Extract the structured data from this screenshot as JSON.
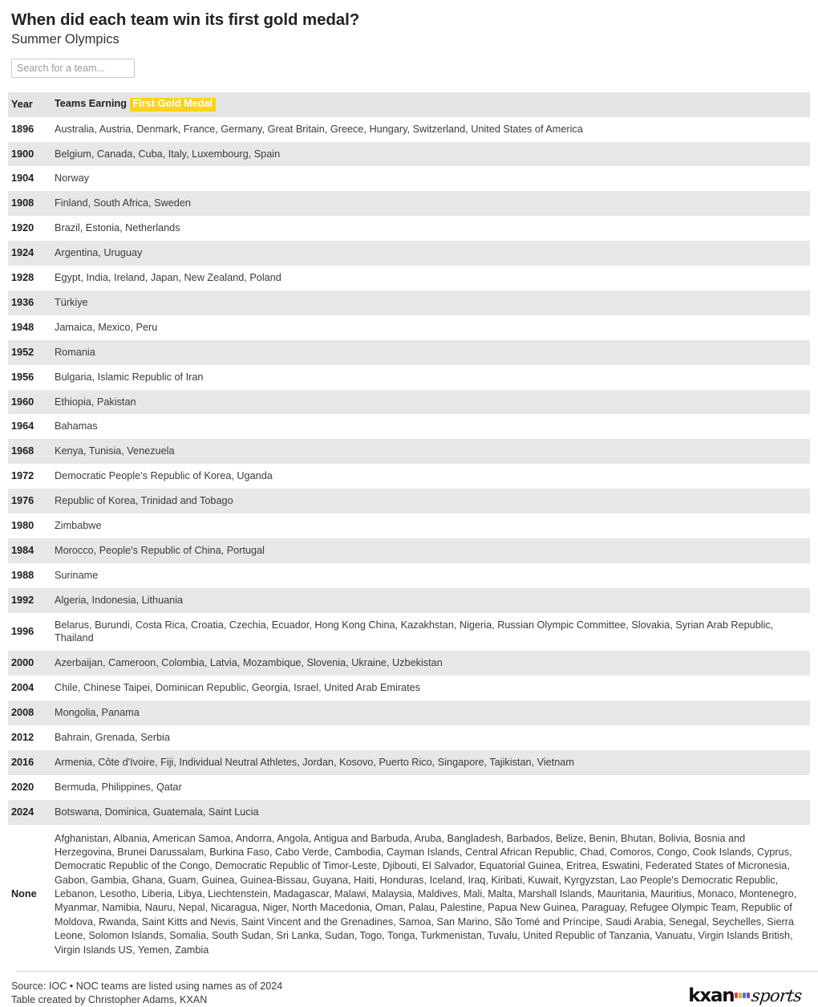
{
  "header": {
    "title": "When did each team win its first gold medal?",
    "subtitle": "Summer Olympics"
  },
  "search": {
    "placeholder": "Search for a team...",
    "value": ""
  },
  "table": {
    "columns": {
      "year": "Year",
      "teams_prefix": "Teams Earning",
      "teams_highlight": "First Gold Medal"
    },
    "rows": [
      {
        "year": "1896",
        "teams": "Australia, Austria, Denmark, France, Germany, Great Britain, Greece, Hungary, Switzerland, United States of America"
      },
      {
        "year": "1900",
        "teams": "Belgium, Canada, Cuba, Italy, Luxembourg, Spain"
      },
      {
        "year": "1904",
        "teams": "Norway"
      },
      {
        "year": "1908",
        "teams": "Finland, South Africa, Sweden"
      },
      {
        "year": "1920",
        "teams": "Brazil, Estonia, Netherlands"
      },
      {
        "year": "1924",
        "teams": "Argentina, Uruguay"
      },
      {
        "year": "1928",
        "teams": "Egypt, India, Ireland, Japan, New Zealand, Poland"
      },
      {
        "year": "1936",
        "teams": "Türkiye"
      },
      {
        "year": "1948",
        "teams": "Jamaica, Mexico, Peru"
      },
      {
        "year": "1952",
        "teams": "Romania"
      },
      {
        "year": "1956",
        "teams": "Bulgaria, Islamic Republic of Iran"
      },
      {
        "year": "1960",
        "teams": "Ethiopia, Pakistan"
      },
      {
        "year": "1964",
        "teams": "Bahamas"
      },
      {
        "year": "1968",
        "teams": "Kenya, Tunisia, Venezuela"
      },
      {
        "year": "1972",
        "teams": "Democratic People's Republic of Korea, Uganda"
      },
      {
        "year": "1976",
        "teams": "Republic of Korea, Trinidad and Tobago"
      },
      {
        "year": "1980",
        "teams": "Zimbabwe"
      },
      {
        "year": "1984",
        "teams": "Morocco, People's Republic of China, Portugal"
      },
      {
        "year": "1988",
        "teams": "Suriname"
      },
      {
        "year": "1992",
        "teams": "Algeria, Indonesia, Lithuania"
      },
      {
        "year": "1996",
        "teams": "Belarus, Burundi, Costa Rica, Croatia, Czechia, Ecuador, Hong Kong China, Kazakhstan, Nigeria, Russian Olympic Committee, Slovakia, Syrian Arab Republic, Thailand"
      },
      {
        "year": "2000",
        "teams": "Azerbaijan, Cameroon, Colombia, Latvia, Mozambique, Slovenia, Ukraine, Uzbekistan"
      },
      {
        "year": "2004",
        "teams": "Chile, Chinese Taipei, Dominican Republic, Georgia, Israel, United Arab Emirates"
      },
      {
        "year": "2008",
        "teams": "Mongolia, Panama"
      },
      {
        "year": "2012",
        "teams": "Bahrain, Grenada, Serbia"
      },
      {
        "year": "2016",
        "teams": "Armenia, Côte d'Ivoire, Fiji, Individual Neutral Athletes, Jordan, Kosovo, Puerto Rico, Singapore, Tajikistan, Vietnam"
      },
      {
        "year": "2020",
        "teams": "Bermuda, Philippines, Qatar"
      },
      {
        "year": "2024",
        "teams": "Botswana, Dominica, Guatemala, Saint Lucia"
      },
      {
        "year": "None",
        "teams": "Afghanistan, Albania, American Samoa, Andorra, Angola, Antigua and Barbuda, Aruba, Bangladesh, Barbados, Belize, Benin, Bhutan, Bolivia, Bosnia and Herzegovina, Brunei Darussalam, Burkina Faso, Cabo Verde, Cambodia, Cayman Islands, Central African Republic, Chad, Comoros, Congo, Cook Islands, Cyprus, Democratic Republic of the Congo, Democratic Republic of Timor-Leste, Djibouti, El Salvador, Equatorial Guinea, Eritrea, Eswatini, Federated States of Micronesia, Gabon, Gambia, Ghana, Guam, Guinea, Guinea-Bissau, Guyana, Haiti, Honduras, Iceland, Iraq, Kiribati, Kuwait, Kyrgyzstan, Lao People's Democratic Republic, Lebanon, Lesotho, Liberia, Libya, Liechtenstein, Madagascar, Malawi, Malaysia, Maldives, Mali, Malta, Marshall Islands, Mauritania, Mauritius, Monaco, Montenegro, Myanmar, Namibia, Nauru, Nepal, Nicaragua, Niger, North Macedonia, Oman, Palau, Palestine, Papua New Guinea, Paraguay, Refugee Olympic Team, Republic of Moldova, Rwanda, Saint Kitts and Nevis, Saint Vincent and the Grenadines, Samoa, San Marino, São Tomé and Príncipe, Saudi Arabia, Senegal, Seychelles, Sierra Leone, Solomon Islands, Somalia, South Sudan, Sri Lanka, Sudan, Togo, Tonga, Turkmenistan, Tuvalu, United Republic of Tanzania, Vanuatu, Virgin Islands British, Virgin Islands US, Yemen, Zambia"
      }
    ]
  },
  "footer": {
    "source": "Source: IOC • NOC teams are listed using names as of 2024",
    "credit": "Table created by Christopher Adams, KXAN",
    "logo": {
      "brand": "kxan",
      "suffix": "sports",
      "dot_colors": [
        "#e8453c",
        "#f5a623",
        "#3b78e7",
        "#8e44ad"
      ]
    }
  },
  "colors": {
    "highlight": "#ffd21e",
    "header_row": "#e4e4e4",
    "stripe": "#e7e7e7"
  }
}
